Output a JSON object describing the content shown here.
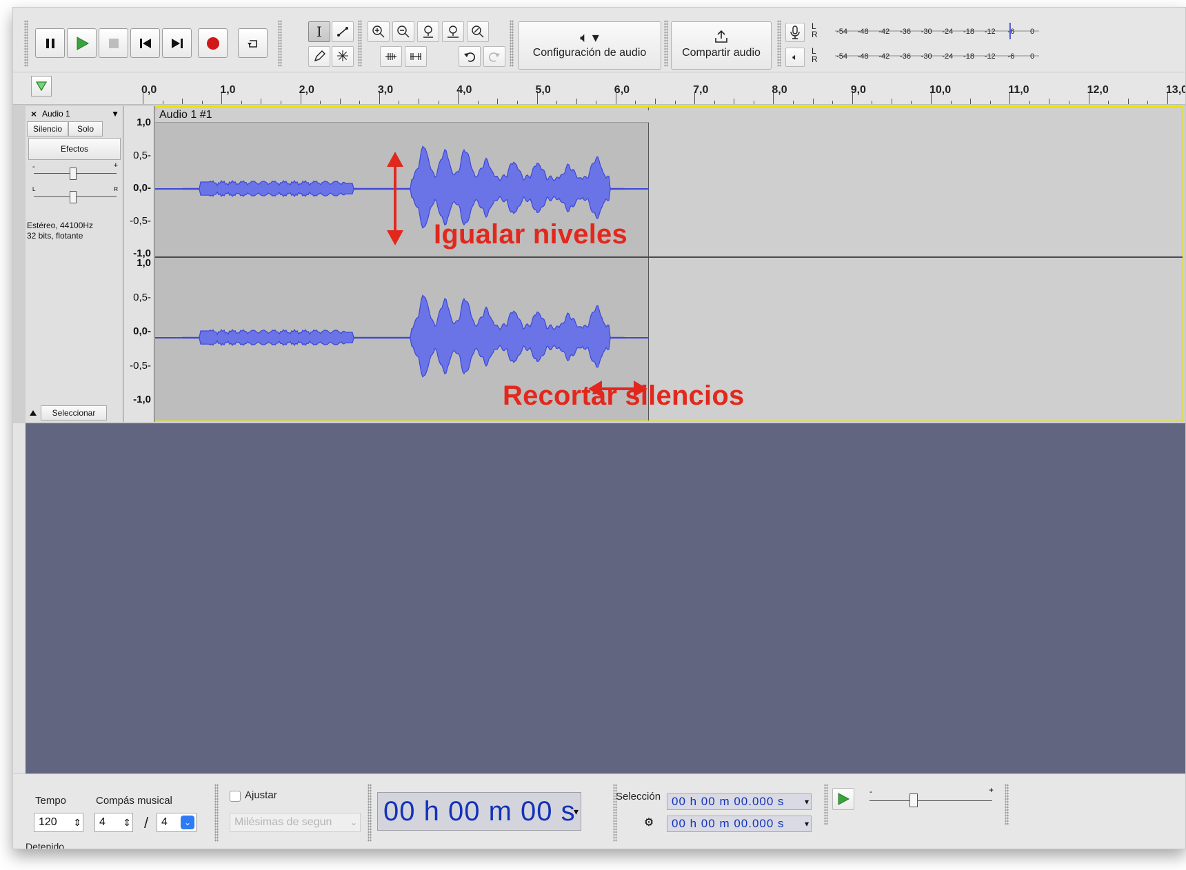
{
  "toolbar": {
    "audio_setup_label": "Configuración de audio",
    "share_audio_label": "Compartir audio",
    "record_meter_scale": [
      "-54",
      "-48",
      "-42",
      "-36",
      "-30",
      "-24",
      "-18",
      "-12",
      "-6",
      "0"
    ],
    "play_meter_scale": [
      "-54",
      "-48",
      "-42",
      "-36",
      "-30",
      "-24",
      "-18",
      "-12",
      "-6",
      "0"
    ],
    "meter_channel_top": "L",
    "meter_channel_bottom": "R",
    "record_level": 0.88,
    "colors": {
      "record": "#d01818",
      "play": "#3ba33b",
      "meter_cursor": "#4a55e0"
    }
  },
  "ruler": {
    "labels": [
      "0,0",
      "1,0",
      "2,0",
      "3,0",
      "4,0",
      "5,0",
      "6,0",
      "7,0",
      "8,0",
      "9,0",
      "10,0",
      "11,0",
      "12,0",
      "13,0"
    ]
  },
  "track": {
    "name": "Audio 1",
    "mute_label": "Silencio",
    "solo_label": "Solo",
    "effects_label": "Efectos",
    "gain_minus": "-",
    "gain_plus": "+",
    "pan_left": "L",
    "pan_right": "R",
    "info_line1": "Estéreo, 44100Hz",
    "info_line2": "32 bits, flotante",
    "select_label": "Seleccionar",
    "clip_name": "Audio 1 #1",
    "vruler_top": [
      "1,0",
      "0,5-",
      "0,0-",
      "-0,5-",
      "-1,0"
    ],
    "vruler_bottom": [
      "1,0",
      "0,5-",
      "0,0-",
      "-0,5-",
      "-1,0"
    ],
    "waveform_color": "#3c47d8",
    "waveform_fill": "#6a74e6"
  },
  "annotations": {
    "levels": "Igualar niveles",
    "silences": "Recortar silencios",
    "color": "#e2281d"
  },
  "bottom": {
    "tempo_label": "Tempo",
    "tempo_value": "120",
    "meter_label": "Compás musical",
    "meter_num": "4",
    "meter_sep": "/",
    "meter_den": "4",
    "snap_label": "Ajustar",
    "snap_unit": "Milésimas de segun",
    "time_display": "00 h 00 m 00 s",
    "selection_label": "Selección",
    "sel_start": "00 h 00 m 00.000 s",
    "sel_end": "00 h 00 m 00.000 s",
    "speed_minus": "-",
    "speed_plus": "+",
    "status_text": "Detenido"
  }
}
